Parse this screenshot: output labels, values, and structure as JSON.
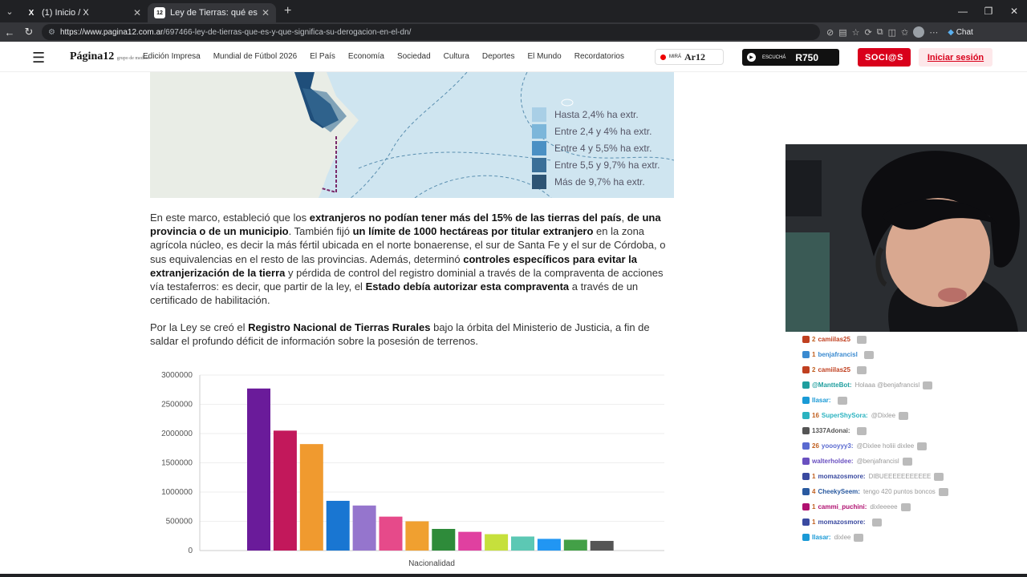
{
  "tabs": [
    {
      "label": "(1) Inicio / X",
      "favicon": "X",
      "active": false
    },
    {
      "label": "Ley de Tierras: qué es y qué signifi",
      "favicon": "12",
      "active": true
    }
  ],
  "addressbar": {
    "url_domain": "https://www.pagina12.com.ar",
    "url_path": "/697466-ley-de-tierras-que-es-y-que-significa-su-derogacion-en-el-dn/",
    "chat_label": "Chat"
  },
  "site": {
    "logo": "Página12",
    "logo_sub": "grupo de medios",
    "nav": [
      "Edición Impresa",
      "Mundial de Fútbol 2026",
      "El País",
      "Economía",
      "Sociedad",
      "Cultura",
      "Deportes",
      "El Mundo",
      "Recordatorios"
    ],
    "radio_prefix": "MIRÁ",
    "radio_brand": "Ar12",
    "listen_prefix": "ESCUCHÁ",
    "listen_freq": "R750",
    "socios": "SOCI@S",
    "login": "Iniciar sesión"
  },
  "map_legend": [
    {
      "label": "Hasta 2,4% ha extr.",
      "color": "#a9cfe6"
    },
    {
      "label": "Entre 2,4 y 4% ha extr.",
      "color": "#7cb6da"
    },
    {
      "label": "Entre 4 y 5,5% ha extr.",
      "color": "#4a90c4"
    },
    {
      "label": "Entre 5,5 y 9,7% ha extr.",
      "color": "#3a6f98"
    },
    {
      "label": "Más de 9,7% ha extr.",
      "color": "#2d5474"
    }
  ],
  "article": {
    "p1": [
      {
        "t": "En este marco, estableció que los ",
        "b": false
      },
      {
        "t": "extranjeros no podían tener más del 15% de las tierras del país",
        "b": true
      },
      {
        "t": ", ",
        "b": false
      },
      {
        "t": "de una provincia o de un municipio",
        "b": true
      },
      {
        "t": ". También fijó ",
        "b": false
      },
      {
        "t": "un límite de 1000 hectáreas por titular extranjero",
        "b": true
      },
      {
        "t": " en la zona agrícola núcleo, es decir la más fértil ubicada en el norte bonaerense, el sur de Santa Fe y el sur de Córdoba, o sus equivalencias en el resto de las provincias. Además, determinó ",
        "b": false
      },
      {
        "t": "controles específicos para evitar la extranjerización de la tierra",
        "b": true
      },
      {
        "t": " y pérdida de control del registro dominial a través de la compraventa de acciones vía testaferros: es decir, que partir de la ley, el ",
        "b": false
      },
      {
        "t": "Estado debía autorizar esta compraventa",
        "b": true
      },
      {
        "t": " a través de un certificado de habilitación.",
        "b": false
      }
    ],
    "p2": [
      {
        "t": "Por la Ley se creó el ",
        "b": false
      },
      {
        "t": "Registro Nacional de Tierras Rurales",
        "b": true
      },
      {
        "t": " bajo la órbita del Ministerio de Justicia, a fin de saldar el profundo déficit de información sobre la posesión de terrenos.",
        "b": false
      }
    ]
  },
  "chart_data": {
    "type": "bar",
    "xlabel": "Nacionalidad",
    "ylabel": "",
    "ylim": [
      0,
      3000000
    ],
    "yticks": [
      "0",
      "500000",
      "1000000",
      "1500000",
      "2000000",
      "2500000",
      "3000000"
    ],
    "values": [
      2770000,
      2050000,
      1820000,
      850000,
      770000,
      580000,
      500000,
      370000,
      320000,
      280000,
      240000,
      200000,
      185000,
      165000
    ],
    "colors": [
      "#6a1b9a",
      "#c2185b",
      "#f09a2f",
      "#1976d2",
      "#9575cd",
      "#e64a8a",
      "#f0a030",
      "#2e8b3a",
      "#e040a0",
      "#c6e03c",
      "#5cc8b4",
      "#2196f3",
      "#43a047",
      "#555555"
    ]
  },
  "chat": [
    {
      "user": "camiilas25",
      "prefix": "2",
      "color": "#c04020",
      "msg": ""
    },
    {
      "user": "benjafrancisl",
      "prefix": "1",
      "color": "#3a8ad0",
      "msg": ""
    },
    {
      "user": "camiilas25",
      "prefix": "2",
      "color": "#c04020",
      "msg": ""
    },
    {
      "user": "@MantteBot:",
      "prefix": "",
      "color": "#1f9e9e",
      "msg": "Holaaa @benjafrancisl"
    },
    {
      "user": "Ilasar:",
      "prefix": "",
      "color": "#1a9ad6",
      "msg": ""
    },
    {
      "user": "SuperShySora:",
      "prefix": "16",
      "color": "#2bb3c0",
      "msg": "@Dixlee"
    },
    {
      "user": "1337Adonai:",
      "prefix": "",
      "color": "#555",
      "msg": ""
    },
    {
      "user": "yoooyyy3:",
      "prefix": "26",
      "color": "#5a6ad0",
      "msg": "@Dixlee holiii dixlee"
    },
    {
      "user": "walterholdee:",
      "prefix": "",
      "color": "#6a50c0",
      "msg": "@benjafrancisl"
    },
    {
      "user": "momazosmore:",
      "prefix": "1",
      "color": "#3a4aa0",
      "msg": "DIBUEEEEEEEEEEE"
    },
    {
      "user": "CheekySeem:",
      "prefix": "4",
      "color": "#2a5aa0",
      "msg": "tengo 420 puntos boncos"
    },
    {
      "user": "cammi_puchini:",
      "prefix": "1",
      "color": "#b01070",
      "msg": "dixleeeee"
    },
    {
      "user": "momazosmore:",
      "prefix": "1",
      "color": "#3a4aa0",
      "msg": ""
    },
    {
      "user": "Ilasar:",
      "prefix": "",
      "color": "#1a9ad6",
      "msg": "dixlee"
    }
  ]
}
